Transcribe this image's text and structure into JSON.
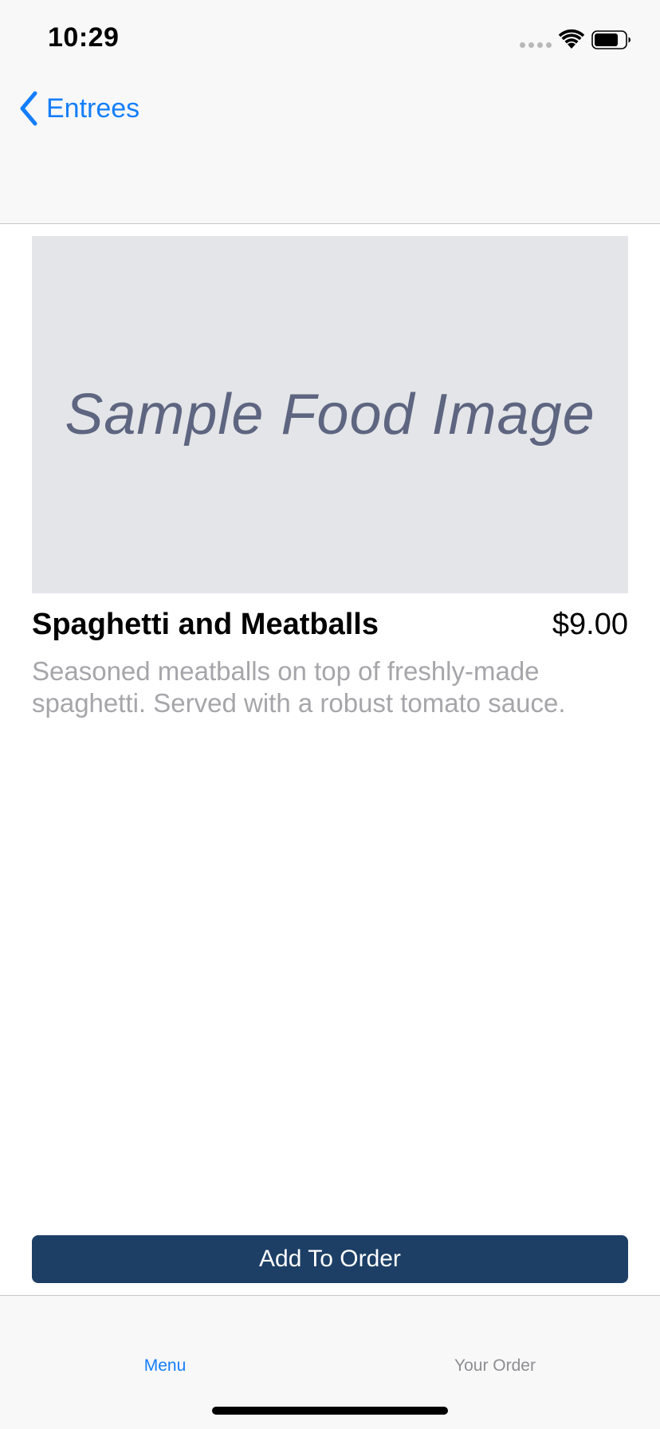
{
  "status_bar": {
    "time": "10:29"
  },
  "nav": {
    "back_label": "Entrees"
  },
  "item": {
    "image_text": "Sample Food Image",
    "title": "Spaghetti and Meatballs",
    "price": "$9.00",
    "description": "Seasoned meatballs on top of freshly-made spaghetti. Served with a robust tomato sauce."
  },
  "actions": {
    "add_label": "Add To Order"
  },
  "tabs": [
    {
      "label": "Menu",
      "selected": true
    },
    {
      "label": "Your Order",
      "selected": false
    }
  ],
  "colors": {
    "accent": "#147efb",
    "button": "#1d3f66",
    "image_placeholder": "#e3e5e8",
    "description_text": "#a6a6aa"
  },
  "icons": {
    "back": "chevron-left-icon",
    "signal": "cellular-signal-icon",
    "wifi": "wifi-icon",
    "battery": "battery-icon"
  }
}
